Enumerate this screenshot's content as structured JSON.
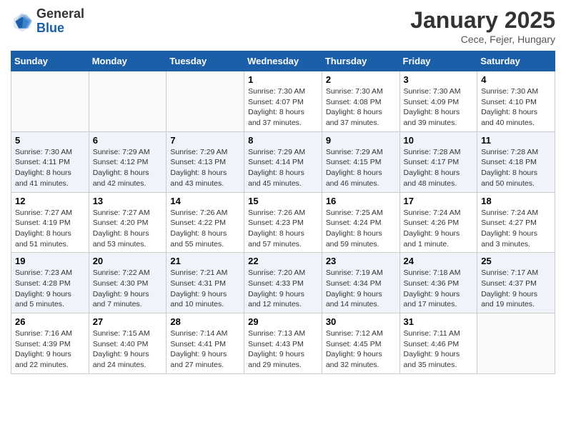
{
  "logo": {
    "general": "General",
    "blue": "Blue"
  },
  "header": {
    "month": "January 2025",
    "location": "Cece, Fejer, Hungary"
  },
  "weekdays": [
    "Sunday",
    "Monday",
    "Tuesday",
    "Wednesday",
    "Thursday",
    "Friday",
    "Saturday"
  ],
  "weeks": [
    [
      {
        "day": "",
        "info": ""
      },
      {
        "day": "",
        "info": ""
      },
      {
        "day": "",
        "info": ""
      },
      {
        "day": "1",
        "info": "Sunrise: 7:30 AM\nSunset: 4:07 PM\nDaylight: 8 hours and 37 minutes."
      },
      {
        "day": "2",
        "info": "Sunrise: 7:30 AM\nSunset: 4:08 PM\nDaylight: 8 hours and 37 minutes."
      },
      {
        "day": "3",
        "info": "Sunrise: 7:30 AM\nSunset: 4:09 PM\nDaylight: 8 hours and 39 minutes."
      },
      {
        "day": "4",
        "info": "Sunrise: 7:30 AM\nSunset: 4:10 PM\nDaylight: 8 hours and 40 minutes."
      }
    ],
    [
      {
        "day": "5",
        "info": "Sunrise: 7:30 AM\nSunset: 4:11 PM\nDaylight: 8 hours and 41 minutes."
      },
      {
        "day": "6",
        "info": "Sunrise: 7:29 AM\nSunset: 4:12 PM\nDaylight: 8 hours and 42 minutes."
      },
      {
        "day": "7",
        "info": "Sunrise: 7:29 AM\nSunset: 4:13 PM\nDaylight: 8 hours and 43 minutes."
      },
      {
        "day": "8",
        "info": "Sunrise: 7:29 AM\nSunset: 4:14 PM\nDaylight: 8 hours and 45 minutes."
      },
      {
        "day": "9",
        "info": "Sunrise: 7:29 AM\nSunset: 4:15 PM\nDaylight: 8 hours and 46 minutes."
      },
      {
        "day": "10",
        "info": "Sunrise: 7:28 AM\nSunset: 4:17 PM\nDaylight: 8 hours and 48 minutes."
      },
      {
        "day": "11",
        "info": "Sunrise: 7:28 AM\nSunset: 4:18 PM\nDaylight: 8 hours and 50 minutes."
      }
    ],
    [
      {
        "day": "12",
        "info": "Sunrise: 7:27 AM\nSunset: 4:19 PM\nDaylight: 8 hours and 51 minutes."
      },
      {
        "day": "13",
        "info": "Sunrise: 7:27 AM\nSunset: 4:20 PM\nDaylight: 8 hours and 53 minutes."
      },
      {
        "day": "14",
        "info": "Sunrise: 7:26 AM\nSunset: 4:22 PM\nDaylight: 8 hours and 55 minutes."
      },
      {
        "day": "15",
        "info": "Sunrise: 7:26 AM\nSunset: 4:23 PM\nDaylight: 8 hours and 57 minutes."
      },
      {
        "day": "16",
        "info": "Sunrise: 7:25 AM\nSunset: 4:24 PM\nDaylight: 8 hours and 59 minutes."
      },
      {
        "day": "17",
        "info": "Sunrise: 7:24 AM\nSunset: 4:26 PM\nDaylight: 9 hours and 1 minute."
      },
      {
        "day": "18",
        "info": "Sunrise: 7:24 AM\nSunset: 4:27 PM\nDaylight: 9 hours and 3 minutes."
      }
    ],
    [
      {
        "day": "19",
        "info": "Sunrise: 7:23 AM\nSunset: 4:28 PM\nDaylight: 9 hours and 5 minutes."
      },
      {
        "day": "20",
        "info": "Sunrise: 7:22 AM\nSunset: 4:30 PM\nDaylight: 9 hours and 7 minutes."
      },
      {
        "day": "21",
        "info": "Sunrise: 7:21 AM\nSunset: 4:31 PM\nDaylight: 9 hours and 10 minutes."
      },
      {
        "day": "22",
        "info": "Sunrise: 7:20 AM\nSunset: 4:33 PM\nDaylight: 9 hours and 12 minutes."
      },
      {
        "day": "23",
        "info": "Sunrise: 7:19 AM\nSunset: 4:34 PM\nDaylight: 9 hours and 14 minutes."
      },
      {
        "day": "24",
        "info": "Sunrise: 7:18 AM\nSunset: 4:36 PM\nDaylight: 9 hours and 17 minutes."
      },
      {
        "day": "25",
        "info": "Sunrise: 7:17 AM\nSunset: 4:37 PM\nDaylight: 9 hours and 19 minutes."
      }
    ],
    [
      {
        "day": "26",
        "info": "Sunrise: 7:16 AM\nSunset: 4:39 PM\nDaylight: 9 hours and 22 minutes."
      },
      {
        "day": "27",
        "info": "Sunrise: 7:15 AM\nSunset: 4:40 PM\nDaylight: 9 hours and 24 minutes."
      },
      {
        "day": "28",
        "info": "Sunrise: 7:14 AM\nSunset: 4:41 PM\nDaylight: 9 hours and 27 minutes."
      },
      {
        "day": "29",
        "info": "Sunrise: 7:13 AM\nSunset: 4:43 PM\nDaylight: 9 hours and 29 minutes."
      },
      {
        "day": "30",
        "info": "Sunrise: 7:12 AM\nSunset: 4:45 PM\nDaylight: 9 hours and 32 minutes."
      },
      {
        "day": "31",
        "info": "Sunrise: 7:11 AM\nSunset: 4:46 PM\nDaylight: 9 hours and 35 minutes."
      },
      {
        "day": "",
        "info": ""
      }
    ]
  ]
}
